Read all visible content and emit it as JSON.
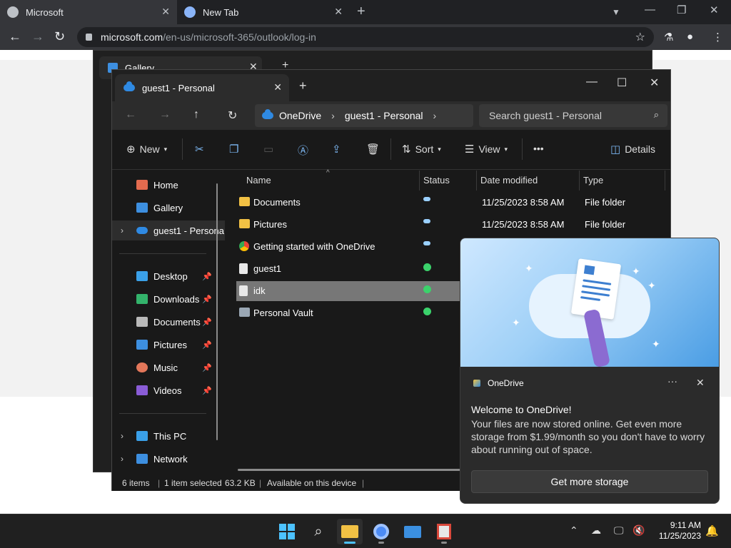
{
  "browser": {
    "tabs": [
      {
        "title": "Microsoft",
        "active": true
      },
      {
        "title": "New Tab",
        "active": false
      }
    ],
    "url_host": "microsoft.com",
    "url_path": "/en-us/microsoft-365/outlook/log-in"
  },
  "gallery_window": {
    "title": "Gallery"
  },
  "explorer": {
    "tab_title": "guest1 - Personal",
    "breadcrumb": [
      "OneDrive",
      "guest1 - Personal"
    ],
    "search_placeholder": "Search guest1 - Personal",
    "commands": {
      "new": "New",
      "sort": "Sort",
      "view": "View",
      "more": "•••",
      "details": "Details"
    },
    "nav": {
      "home": "Home",
      "gallery": "Gallery",
      "onedrive": "guest1 - Persona",
      "quick": [
        {
          "label": "Desktop",
          "color": "#3aa0e8"
        },
        {
          "label": "Downloads",
          "color": "#33b36b"
        },
        {
          "label": "Documents",
          "color": "#b9b9b9"
        },
        {
          "label": "Pictures",
          "color": "#3d8fe0"
        },
        {
          "label": "Music",
          "color": "#e3775a"
        },
        {
          "label": "Videos",
          "color": "#8a5cd6"
        }
      ],
      "this_pc": "This PC",
      "network": "Network"
    },
    "columns": {
      "name": "Name",
      "status": "Status",
      "date": "Date modified",
      "type": "Type"
    },
    "files": [
      {
        "name": "Documents",
        "date": "11/25/2023 8:58 AM",
        "type": "File folder",
        "status": "cloud",
        "icon": "folder"
      },
      {
        "name": "Pictures",
        "date": "11/25/2023 8:58 AM",
        "type": "File folder",
        "status": "cloud",
        "icon": "folder"
      },
      {
        "name": "Getting started with OneDrive",
        "date": "",
        "type": "",
        "status": "cloud",
        "icon": "chrome"
      },
      {
        "name": "guest1",
        "date": "",
        "type": "",
        "status": "ok",
        "icon": "file"
      },
      {
        "name": "idk",
        "date": "",
        "type": "",
        "status": "ok",
        "icon": "file",
        "selected": true
      },
      {
        "name": "Personal Vault",
        "date": "",
        "type": "",
        "status": "ok",
        "icon": "vault"
      }
    ],
    "statusbar": {
      "count": "6 items",
      "selected": "1 item selected",
      "size": "63.2 KB",
      "availability": "Available on this device"
    }
  },
  "toast": {
    "app": "OneDrive",
    "more": "···",
    "title": "Welcome to OneDrive!",
    "body": "Your files are now stored online. Get even more storage from $1.99/month so you don't have to worry about running out of space.",
    "button": "Get more storage"
  },
  "taskbar": {
    "time": "9:11 AM",
    "date": "11/25/2023",
    "accent": "#4cc2ff"
  }
}
